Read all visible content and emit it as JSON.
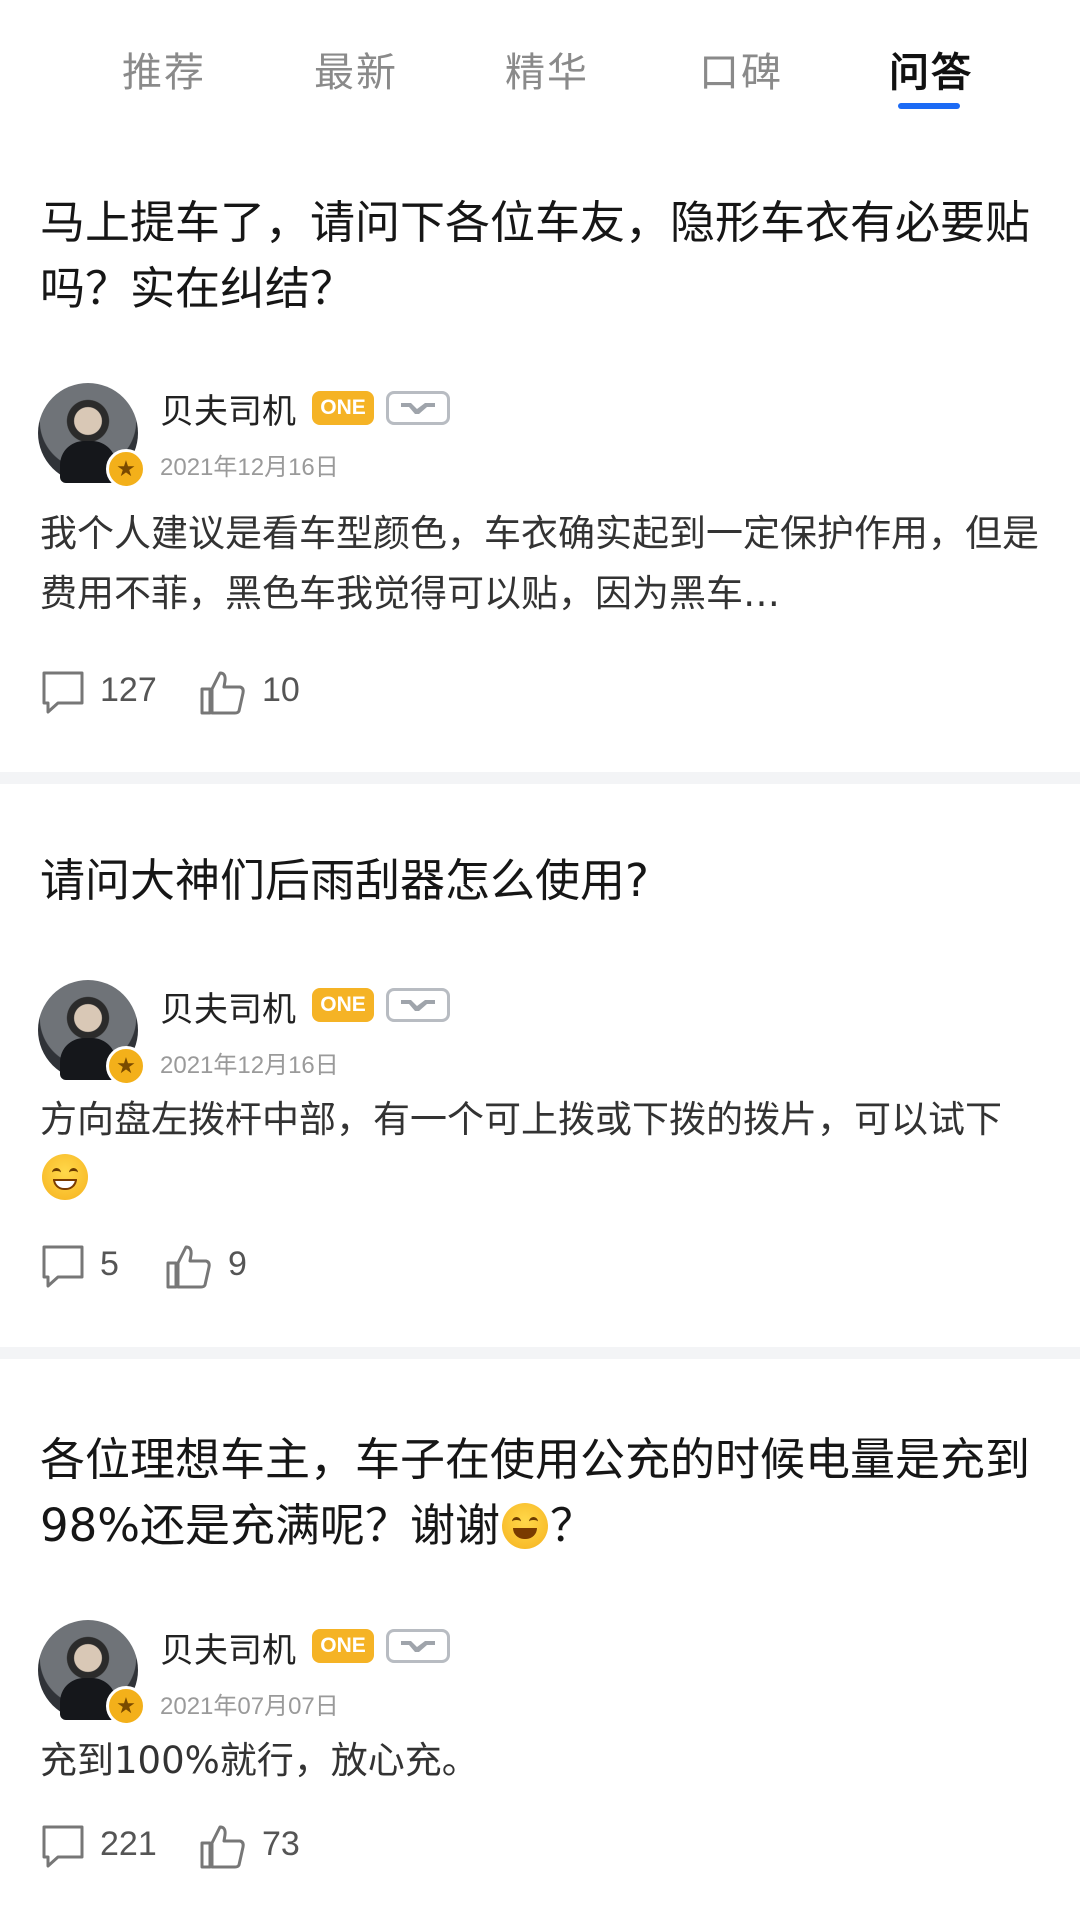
{
  "tabs": [
    "推荐",
    "最新",
    "精华",
    "口碑",
    "问答"
  ],
  "active_tab": "问答",
  "colors": {
    "accent": "#1c6bf5",
    "badge_one": "#f5b325"
  },
  "posts": [
    {
      "question": "马上提车了，请问下各位车友，隐形车衣有必要贴吗？实在纠结？",
      "author": "贝夫司机",
      "badge": "ONE",
      "date": "2021年12月16日",
      "answer": "我个人建议是看车型颜色，车衣确实起到一定保护作用，但是费用不菲，黑色车我觉得可以贴，因为黑车…",
      "comments": "127",
      "likes": "10"
    },
    {
      "question": "请问大神们后雨刮器怎么使用?",
      "author": "贝夫司机",
      "badge": "ONE",
      "date": "2021年12月16日",
      "answer": "方向盘左拨杆中部，有一个可上拨或下拨的拨片，可以试下",
      "answer_emoji": "grin-emoji",
      "comments": "5",
      "likes": "9"
    },
    {
      "question_part1": "各位理想车主，车子在使用公充的时候电量是充到98%还是充满呢？谢谢",
      "question_emoji": "smile-emoji",
      "question_part2": "？",
      "author": "贝夫司机",
      "badge": "ONE",
      "date": "2021年07月07日",
      "answer": "充到100%就行，放心充。",
      "comments": "221",
      "likes": "73"
    }
  ]
}
